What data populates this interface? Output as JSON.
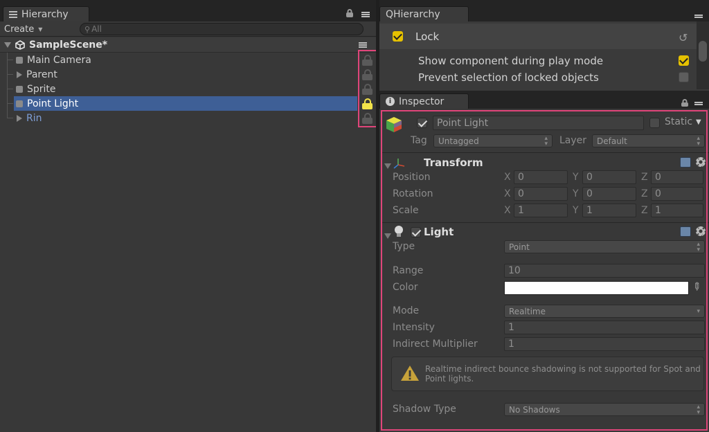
{
  "hierarchy": {
    "tab_title": "Hierarchy",
    "create_label": "Create",
    "search_placeholder": "All",
    "scene_name": "SampleScene*",
    "items": [
      {
        "label": "Main Camera",
        "expandable": false,
        "selected": false,
        "locked": false,
        "is_prefab": false
      },
      {
        "label": "Parent",
        "expandable": true,
        "selected": false,
        "locked": false,
        "is_prefab": false
      },
      {
        "label": "Sprite",
        "expandable": false,
        "selected": false,
        "locked": false,
        "is_prefab": false
      },
      {
        "label": "Point Light",
        "expandable": false,
        "selected": true,
        "locked": true,
        "is_prefab": false
      },
      {
        "label": "Rin",
        "expandable": true,
        "selected": false,
        "locked": false,
        "is_prefab": true
      }
    ]
  },
  "qhierarchy": {
    "tab_title": "QHierarchy",
    "lock_label": "Lock",
    "lock_enabled": true,
    "options": [
      {
        "label": "Show component during play mode",
        "checked": true
      },
      {
        "label": "Prevent selection of locked objects",
        "checked": false
      }
    ]
  },
  "inspector": {
    "tab_title": "Inspector",
    "object_active": true,
    "object_name": "Point Light",
    "static_label": "Static",
    "static_checked": false,
    "tag_label": "Tag",
    "tag_value": "Untagged",
    "layer_label": "Layer",
    "layer_value": "Default",
    "transform": {
      "title": "Transform",
      "rows": [
        {
          "label": "Position",
          "x": "0",
          "y": "0",
          "z": "0"
        },
        {
          "label": "Rotation",
          "x": "0",
          "y": "0",
          "z": "0"
        },
        {
          "label": "Scale",
          "x": "1",
          "y": "1",
          "z": "1"
        }
      ],
      "axes": [
        "X",
        "Y",
        "Z"
      ]
    },
    "light": {
      "title": "Light",
      "enabled": true,
      "type_label": "Type",
      "type_value": "Point",
      "range_label": "Range",
      "range_value": "10",
      "color_label": "Color",
      "color_value": "#ffffff",
      "mode_label": "Mode",
      "mode_value": "Realtime",
      "intensity_label": "Intensity",
      "intensity_value": "1",
      "indirect_label": "Indirect Multiplier",
      "indirect_value": "1",
      "warning_line1": "Realtime indirect bounce shadowing is not supported for Spot and",
      "warning_line2": "Point lights.",
      "shadow_label": "Shadow Type",
      "shadow_value": "No Shadows"
    }
  },
  "colors": {
    "selection": "#3e5f96",
    "lock_active": "#f2e34a",
    "highlight_box": "#e0457a",
    "prefab_text": "#7f9fd7"
  }
}
